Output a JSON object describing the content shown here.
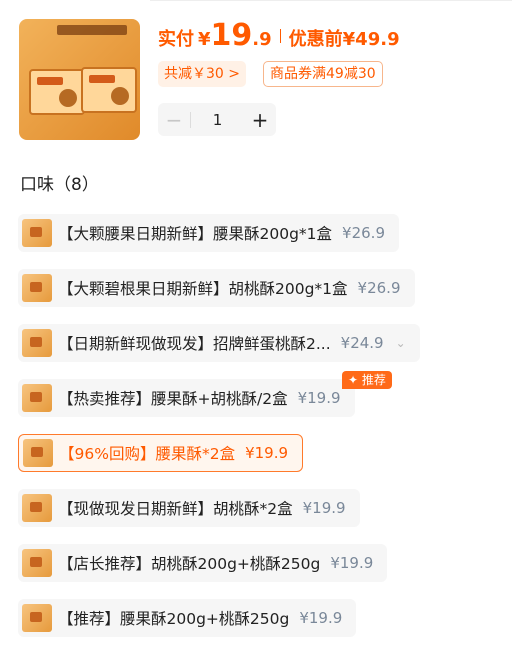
{
  "product": {
    "image_icon": "product-image",
    "price_label": "实付",
    "currency": "¥",
    "price_int": "19",
    "price_dec": ".9",
    "before_label": "优惠前",
    "before_price": "¥49.9",
    "discount_tag": "共减￥30 >",
    "coupon_tag": "商品券满49减30"
  },
  "quantity": {
    "minus": "−",
    "value": "1",
    "plus": "+"
  },
  "flavor_section": {
    "title": "口味（8）"
  },
  "options": [
    {
      "name": "【大颗腰果日期新鲜】腰果酥200g*1盒",
      "price": "¥26.9"
    },
    {
      "name": "【大颗碧根果日期新鲜】胡桃酥200g*1盒",
      "price": "¥26.9"
    },
    {
      "name": "【日期新鲜现做现发】招牌鲜蛋桃酥2...",
      "price": "¥24.9",
      "chevron": "⌄"
    },
    {
      "name": "【热卖推荐】腰果酥+胡桃酥/2盒",
      "price": "¥19.9",
      "badge": "✦ 推荐"
    },
    {
      "name": "【96%回购】腰果酥*2盒",
      "price": "¥19.9",
      "selected": true
    },
    {
      "name": "【现做现发日期新鲜】胡桃酥*2盒",
      "price": "¥19.9"
    },
    {
      "name": "【店长推荐】胡桃酥200g+桃酥250g",
      "price": "¥19.9"
    },
    {
      "name": "【推荐】腰果酥200g+桃酥250g",
      "price": "¥19.9"
    }
  ],
  "colors": {
    "accent": "#ff5a00",
    "selected_border": "#ff7a2b",
    "muted_price": "#7a8899"
  }
}
